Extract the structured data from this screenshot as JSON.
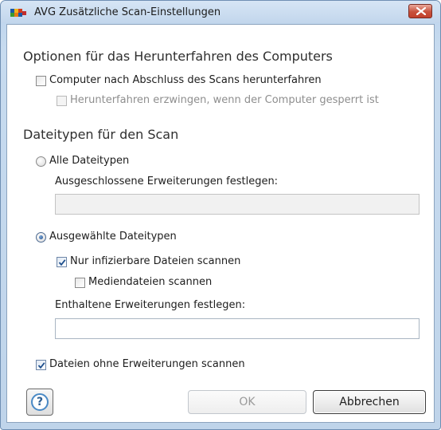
{
  "window": {
    "title": "AVG Zusätzliche Scan-Einstellungen",
    "close_icon": "close-x-icon"
  },
  "shutdown": {
    "heading": "Optionen für das Herunterfahren des Computers",
    "shutdown_after_scan": {
      "label": "Computer nach Abschluss des Scans herunterfahren",
      "checked": false,
      "enabled": true
    },
    "force_shutdown": {
      "label": "Herunterfahren erzwingen, wenn der Computer gesperrt ist",
      "checked": false,
      "enabled": false
    }
  },
  "filetypes": {
    "heading": "Dateitypen für den Scan",
    "all_types": {
      "label": "Alle Dateitypen",
      "selected": false,
      "excluded_label": "Ausgeschlossene Erweiterungen festlegen:",
      "excluded_value": ""
    },
    "selected_types": {
      "label": "Ausgewählte Dateitypen",
      "selected": true,
      "infectable_only": {
        "label": "Nur infizierbare Dateien scannen",
        "checked": true
      },
      "media_files": {
        "label": "Mediendateien scannen",
        "checked": false
      },
      "included_label": "Enthaltene Erweiterungen festlegen:",
      "included_value": ""
    },
    "no_extension": {
      "label": "Dateien ohne Erweiterungen scannen",
      "checked": true
    }
  },
  "buttons": {
    "help_label": "?",
    "ok_label": "OK",
    "cancel_label": "Abbrechen"
  },
  "colors": {
    "frame": "#bfd4ea",
    "close_button": "#c8513c",
    "check_tick": "#1e4f8d"
  }
}
